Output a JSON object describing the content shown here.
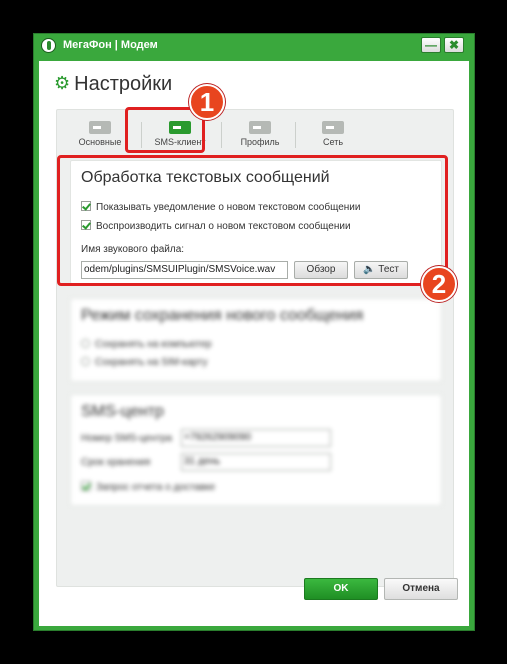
{
  "window": {
    "title": "МегаФон | Модем"
  },
  "titlebar": {
    "minimize_glyph": "—",
    "close_glyph": "✖"
  },
  "heading": "Настройки",
  "tabs": [
    {
      "label": "Основные",
      "icon": "general-icon",
      "active": false
    },
    {
      "label": "SMS-клиент",
      "icon": "sms-client-icon",
      "active": true
    },
    {
      "label": "Профиль",
      "icon": "profile-icon",
      "active": false
    },
    {
      "label": "Сеть",
      "icon": "network-icon",
      "active": false
    }
  ],
  "sms_processing": {
    "title": "Обработка текстовых сообщений",
    "show_notification": {
      "label": "Показывать уведомление о новом текстовом сообщении",
      "checked": true
    },
    "play_sound": {
      "label": "Воспроизводить сигнал о новом текстовом сообщении",
      "checked": true
    },
    "sound_file_label": "Имя звукового файла:",
    "sound_file_value": "odem/plugins/SMSUIPlugin/SMSVoice.wav",
    "browse_label": "Обзор",
    "test_label": "Тест"
  },
  "save_mode": {
    "title": "Режим сохранения нового сообщения",
    "options": [
      "Сохранять на компьютер",
      "Сохранять на SIM-карту"
    ]
  },
  "sms_center": {
    "title": "SMS-центр",
    "number_label": "Номер SMS-центра",
    "number_value": "+79262909090",
    "validity_label": "Срок хранения",
    "validity_value": "31 день",
    "report_label": "Запрос отчета о доставке"
  },
  "annotations": {
    "badge1": "1",
    "badge2": "2",
    "color": "#e02020"
  },
  "footer": {
    "ok_label": "OK",
    "cancel_label": "Отмена"
  },
  "colors": {
    "accent": "#3aa83d",
    "ok_button": "#2a9a2e"
  }
}
